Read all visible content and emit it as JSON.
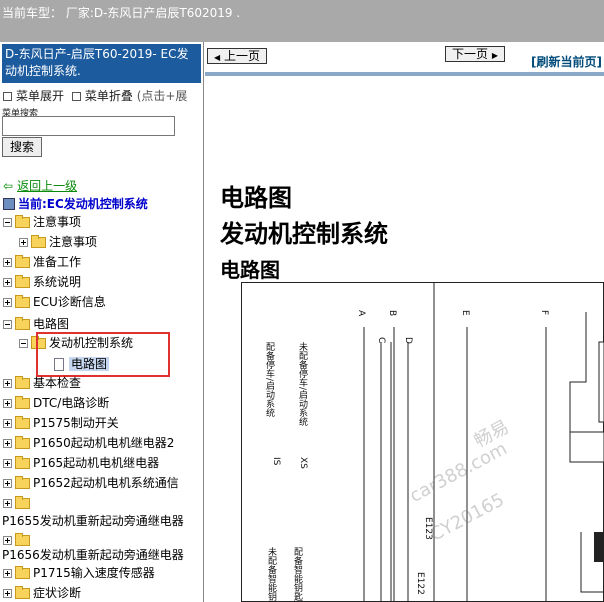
{
  "top_bar": {
    "car_model_text": "当前车型：  厂家:D-东风日产启辰T602019  ."
  },
  "sidebar": {
    "title": "D-东风日产-启辰T60-2019- EC发动机控制系统.",
    "expand_label": "菜单展开",
    "collapse_label": "菜单折叠",
    "collapse_hint": "(点击+展",
    "search_label": "菜单搜索",
    "search_value": "",
    "search_button": "搜索",
    "back_link": "返回上一级",
    "current_label": "当前:EC发动机控制系统",
    "tree": [
      {
        "label": "注意事项"
      },
      {
        "label": "注意事项"
      },
      {
        "label": "准备工作"
      },
      {
        "label": "系统说明"
      },
      {
        "label": "ECU诊断信息"
      },
      {
        "label": "电路图"
      },
      {
        "label": "发动机控制系统"
      },
      {
        "label": "电路图"
      },
      {
        "label": "基本检查"
      },
      {
        "label": "DTC/电路诊断"
      },
      {
        "label": "P1575制动开关"
      },
      {
        "label": "P1650起动机电机继电器2"
      },
      {
        "label": "P165起动机电机继电器"
      },
      {
        "label": "P1652起动机电机系统通信"
      },
      {
        "label": "P1655发动机重新起动旁通继电器"
      },
      {
        "label": "P1656发动机重新起动旁通继电器"
      },
      {
        "label": "P1715输入速度传感器"
      },
      {
        "label": "症状诊断"
      }
    ]
  },
  "content": {
    "prev_button": "上一页",
    "next_button": "下一页",
    "refresh_link": "[刷新当前页]",
    "heading_1": "电路图",
    "heading_2": "发动机控制系统",
    "heading_3": "电路图",
    "diagram": {
      "connectors": [
        "A",
        "B",
        "C",
        "D",
        "E",
        "F"
      ],
      "labels": [
        "配备停车/启动系统",
        "未配备停车/启动系统",
        "IS",
        "XS",
        "未配备智能钥匙",
        "配备智能钥匙",
        "E122",
        "E123"
      ]
    },
    "watermark": [
      "畅易",
      "car388.com",
      "CY20165"
    ]
  },
  "colors": {
    "sidebar_title_bg": "#1c5b9e",
    "top_bar_bg": "#a9a9a9",
    "highlight": "#e0312f",
    "link_green": "#0a8a0a"
  }
}
